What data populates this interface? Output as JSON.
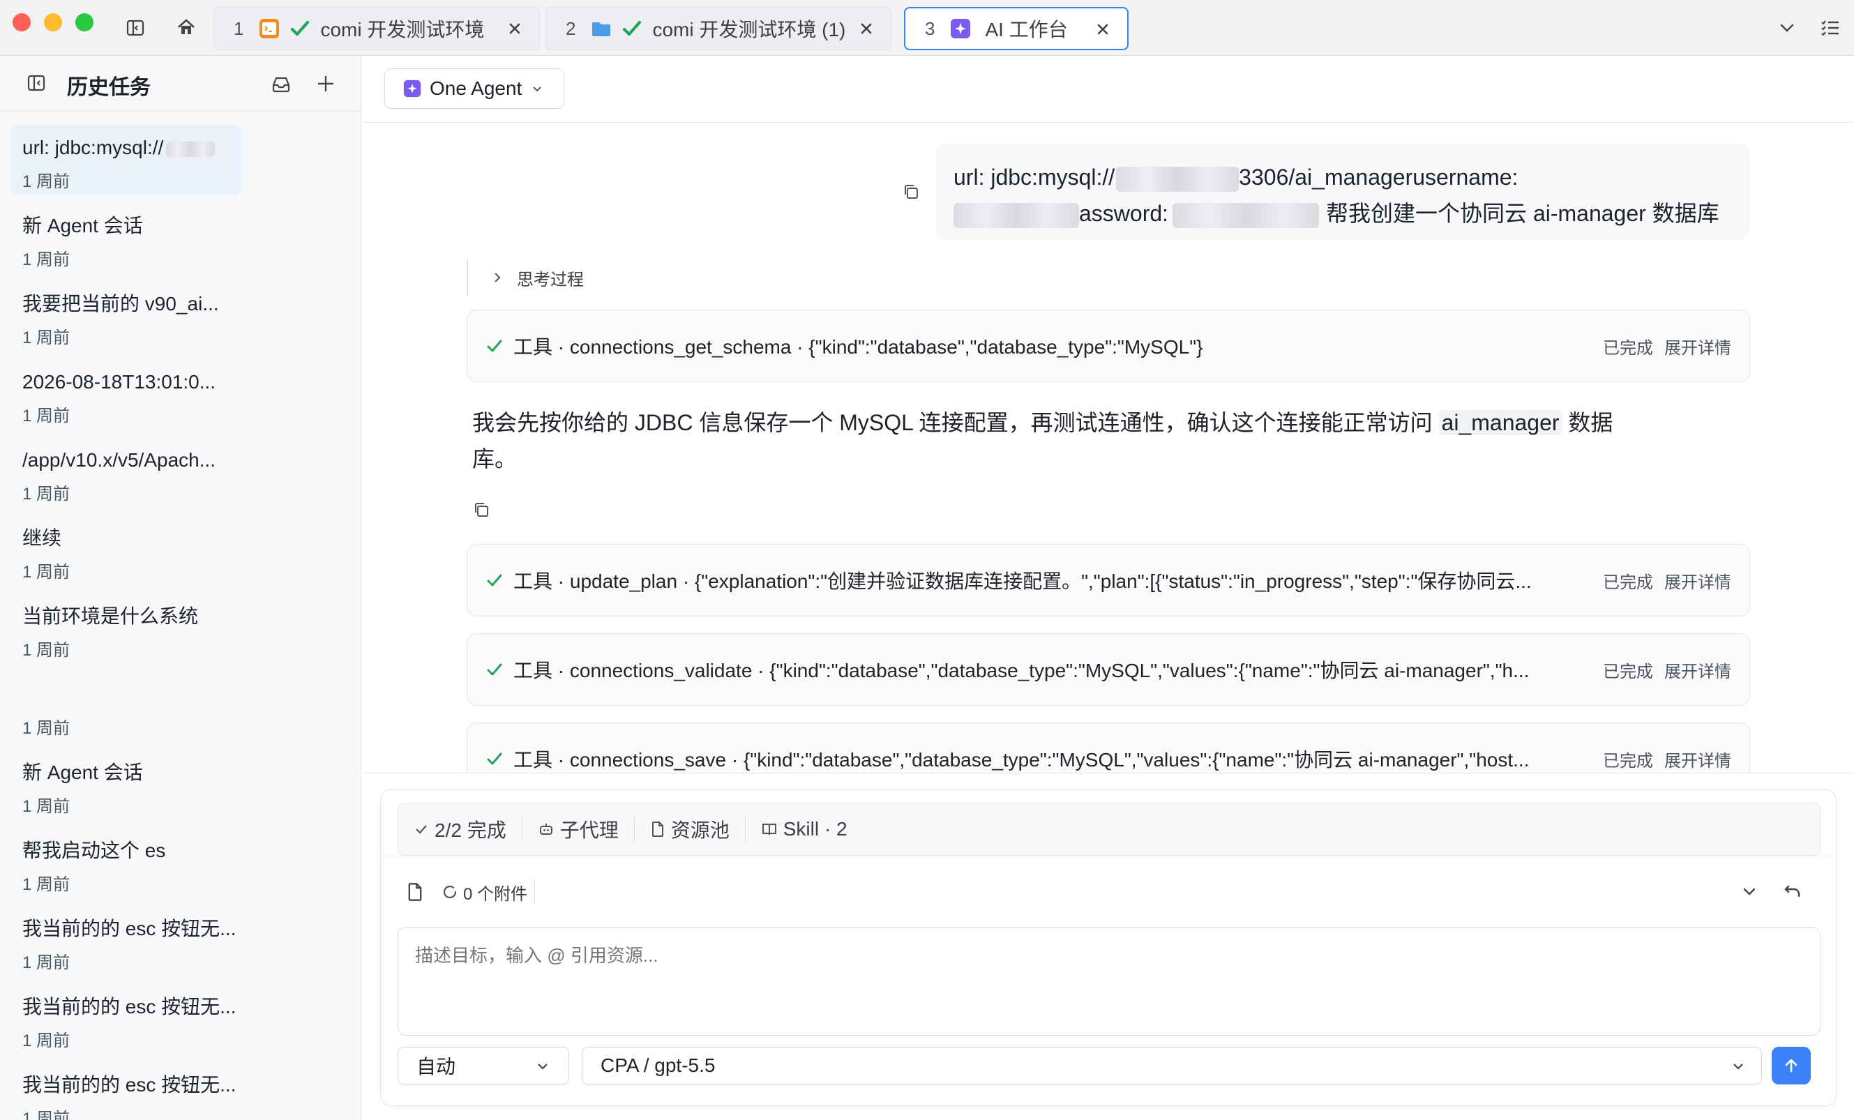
{
  "tabs": [
    {
      "num": "1",
      "title": "comi 开发测试环境",
      "icon": "terminal-icon"
    },
    {
      "num": "2",
      "title": "comi 开发测试环境 (1)",
      "icon": "folder-icon"
    },
    {
      "num": "3",
      "title": "AI 工作台",
      "icon": "ai-icon",
      "active": true
    }
  ],
  "sidebar": {
    "title": "历史任务",
    "items": [
      {
        "title": "url: jdbc:mysql://",
        "time": "1 周前",
        "selected": true
      },
      {
        "title": "新 Agent 会话",
        "time": "1 周前"
      },
      {
        "title": "我要把当前的 v90_ai...",
        "time": "1 周前"
      },
      {
        "title": "2026-08-18T13:01:0...",
        "time": "1 周前"
      },
      {
        "title": "/app/v10.x/v5/Apach...",
        "time": "1 周前"
      },
      {
        "title": "继续",
        "time": "1 周前"
      },
      {
        "title": "当前环境是什么系统",
        "time": "1 周前"
      },
      {
        "title": "",
        "time": "1 周前"
      },
      {
        "title": "新 Agent 会话",
        "time": "1 周前"
      },
      {
        "title": "帮我启动这个 es",
        "time": "1 周前"
      },
      {
        "title": "我当前的的 esc 按钮无...",
        "time": "1 周前"
      },
      {
        "title": "我当前的的 esc 按钮无...",
        "time": "1 周前"
      },
      {
        "title": "我当前的的 esc 按钮无...",
        "time": "1 周前"
      }
    ]
  },
  "agent_selector": {
    "label": "One Agent"
  },
  "chat": {
    "user_msg": {
      "p1": "url: jdbc:mysql://",
      "p2": "3306/ai_managerusername:",
      "p3": "assword:",
      "p4": "帮我创建一个协同云 ai-manager 数据库"
    },
    "thinking_label": "思考过程",
    "tools": [
      {
        "text": "工具 · connections_get_schema · {\"kind\":\"database\",\"database_type\":\"MySQL\"}",
        "status": "已完成",
        "detail": "展开详情"
      },
      {
        "text": "工具 · update_plan · {\"explanation\":\"创建并验证数据库连接配置。\",\"plan\":[{\"status\":\"in_progress\",\"step\":\"保存协同云...",
        "status": "已完成",
        "detail": "展开详情"
      },
      {
        "text": "工具 · connections_validate · {\"kind\":\"database\",\"database_type\":\"MySQL\",\"values\":{\"name\":\"协同云 ai-manager\",\"h...",
        "status": "已完成",
        "detail": "展开详情"
      },
      {
        "text": "工具 · connections_save · {\"kind\":\"database\",\"database_type\":\"MySQL\",\"values\":{\"name\":\"协同云 ai-manager\",\"host...",
        "status": "已完成",
        "detail": "展开详情"
      }
    ],
    "assistant_msg": {
      "before": "我会先按你给的 JDBC 信息保存一个 MySQL 连接配置，再测试连通性，确认这个连接能正常访问 ",
      "code": "ai_manager",
      "after": " 数据",
      "line2": "库。"
    }
  },
  "composer": {
    "status": {
      "progress": "2/2 完成",
      "subagent": "子代理",
      "resources": "资源池",
      "skill": "Skill · 2"
    },
    "attachments": "0 个附件",
    "placeholder": "描述目标，输入 @ 引用资源...",
    "mode": "自动",
    "model": "CPA / gpt-5.5"
  },
  "colors": {
    "accent": "#3b82f6",
    "success": "#22a35a",
    "close": "#ff5f57",
    "minimize": "#febc2e",
    "zoom": "#28c840"
  }
}
